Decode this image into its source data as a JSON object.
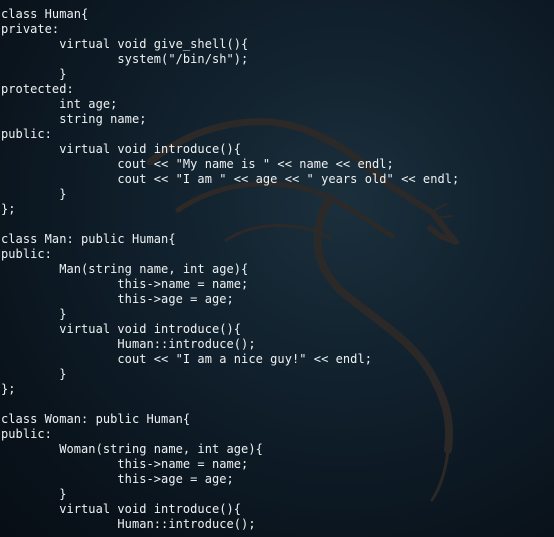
{
  "terminal": {
    "background_color": "#0d1a25",
    "text_color": "#eef2f4",
    "wallpaper_icon": "kali-dragon-icon",
    "lines": [
      "class Human{",
      "private:",
      "        virtual void give_shell(){",
      "                system(\"/bin/sh\");",
      "        }",
      "protected:",
      "        int age;",
      "        string name;",
      "public:",
      "        virtual void introduce(){",
      "                cout << \"My name is \" << name << endl;",
      "                cout << \"I am \" << age << \" years old\" << endl;",
      "        }",
      "};",
      "",
      "class Man: public Human{",
      "public:",
      "        Man(string name, int age){",
      "                this->name = name;",
      "                this->age = age;",
      "        }",
      "        virtual void introduce(){",
      "                Human::introduce();",
      "                cout << \"I am a nice guy!\" << endl;",
      "        }",
      "};",
      "",
      "class Woman: public Human{",
      "public:",
      "        Woman(string name, int age){",
      "                this->name = name;",
      "                this->age = age;",
      "        }",
      "        virtual void introduce(){",
      "                Human::introduce();"
    ]
  }
}
